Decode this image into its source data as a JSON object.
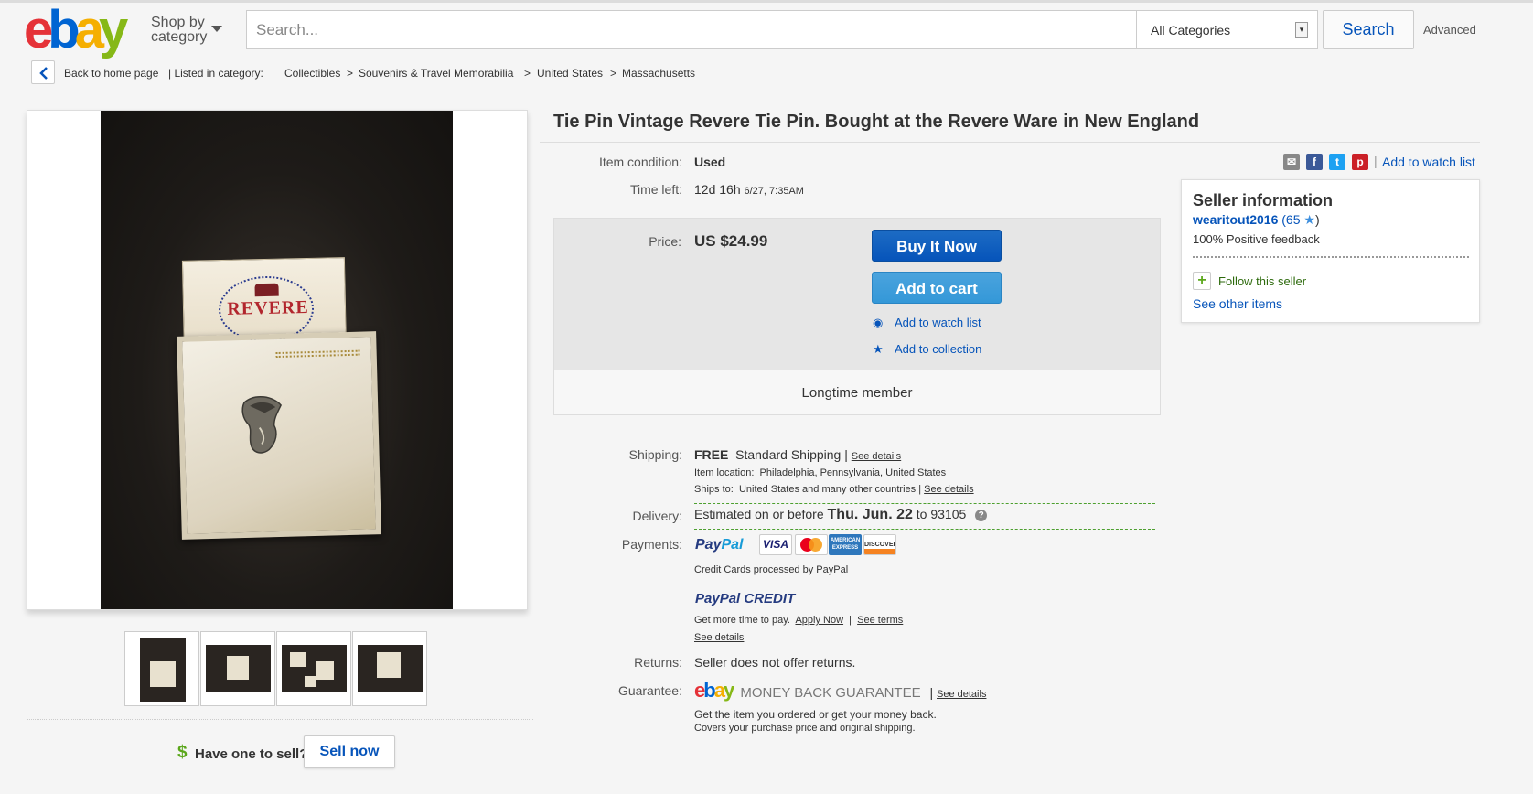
{
  "header": {
    "logo_text": "ebay",
    "shop_by_line1": "Shop by",
    "shop_by_line2": "category",
    "search_placeholder": "Search...",
    "category_value": "All Categories",
    "search_button": "Search",
    "advanced_link": "Advanced"
  },
  "breadcrumb": {
    "back_label": "Back to home page",
    "listed_in": "| Listed in category:",
    "items": [
      "Collectibles",
      "Souvenirs & Travel Memorabilia",
      "United States",
      "Massachusetts"
    ],
    "separator": ">"
  },
  "gallery": {
    "main_image_brand": "REVERE",
    "thumbnail_count": 4
  },
  "sell": {
    "icon": "$",
    "prompt": "Have one to sell?",
    "button": "Sell now"
  },
  "item": {
    "title": "Tie Pin Vintage Revere Tie Pin. Bought at the Revere Ware in New England",
    "condition_label": "Item condition:",
    "condition_value": "Used",
    "time_label": "Time left:",
    "time_value": "12d 16h",
    "time_end": "6/27, 7:35AM",
    "watch_link": "Add to watch list",
    "share_icons": [
      "email-icon",
      "facebook-icon",
      "twitter-icon",
      "pinterest-icon"
    ]
  },
  "buybox": {
    "price_label": "Price:",
    "price_value": "US $24.99",
    "buy_now": "Buy It Now",
    "add_cart": "Add to cart",
    "watch": "Add to watch list",
    "collection": "Add to collection",
    "member": "Longtime member"
  },
  "seller": {
    "title": "Seller information",
    "name": "wearitout2016",
    "score_open": "(65",
    "score_close": ")",
    "feedback": "100% Positive feedback",
    "follow": "Follow this seller",
    "see_other": "See other items"
  },
  "shipping": {
    "label": "Shipping:",
    "free": "FREE",
    "method": "Standard Shipping |",
    "details": "See details",
    "location_label": "Item location:",
    "location": "Philadelphia, Pennsylvania, United States",
    "ships_label": "Ships to:",
    "ships_to": "United States and many other countries |",
    "ships_details": "See details"
  },
  "delivery": {
    "label": "Delivery:",
    "prefix": "Estimated on or before",
    "date": "Thu. Jun. 22",
    "suffix": "to 93105"
  },
  "payments": {
    "label": "Payments:",
    "paypal_a": "Pay",
    "paypal_b": "Pal",
    "cards": [
      "VISA",
      "MasterCard",
      "AMERICAN EXPRESS",
      "DISCOVER"
    ],
    "processed": "Credit Cards processed by PayPal",
    "credit_logo_a": "PayPal",
    "credit_logo_b": "CREDIT",
    "credit_text": "Get more time to pay.",
    "apply_now": "Apply Now",
    "see_terms": "See terms",
    "see_details": "See details"
  },
  "returns": {
    "label": "Returns:",
    "value": "Seller does not offer returns."
  },
  "guarantee": {
    "label": "Guarantee:",
    "logo": "ebay",
    "logo_text": "MONEY BACK GUARANTEE",
    "details": "See details",
    "line1": "Get the item you ordered or get your money back.",
    "line2": "Covers your purchase price and original shipping."
  }
}
